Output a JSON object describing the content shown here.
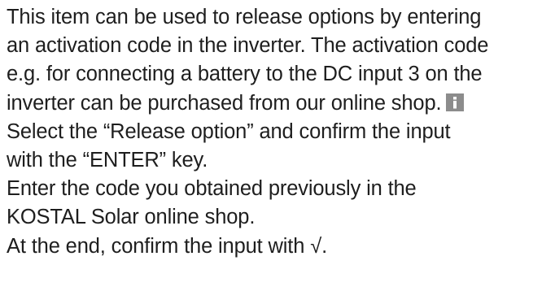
{
  "paragraph1": {
    "lines": [
      "This item can be used to release options by entering",
      "an activation code in the inverter. The activation code",
      "e.g. for connecting a battery to the DC input 3 on the",
      "inverter can be purchased from our online shop."
    ],
    "icon": "info-icon"
  },
  "steps": {
    "step1_lines": [
      "Select the “Release option” and confirm the input",
      "with the “ENTER” key."
    ],
    "step2_lines": [
      "Enter the code you obtained previously in the",
      "KOSTAL Solar online shop."
    ],
    "step3_text": "At the end, confirm the input with ",
    "step3_symbol": "√",
    "step3_end": "."
  }
}
